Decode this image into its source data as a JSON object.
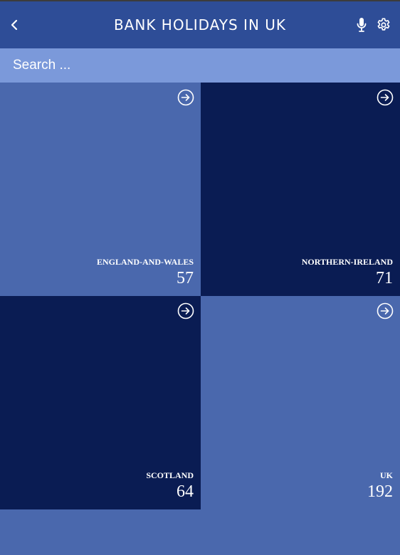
{
  "header": {
    "title": "BANK HOLIDAYS IN UK",
    "back_icon": "chevron-left-icon",
    "mic_icon": "microphone-icon",
    "settings_icon": "gear-icon"
  },
  "search": {
    "placeholder": "Search ...",
    "value": ""
  },
  "colors": {
    "header_bg": "#2e4d97",
    "search_bg": "#7b99da",
    "tile_light": "#4a68ad",
    "tile_dark": "#0a1c53",
    "text": "#ffffff"
  },
  "tiles": [
    {
      "name": "ENGLAND-AND-WALES",
      "count": "57",
      "icon": "arrow-circle-right-icon",
      "style": "light"
    },
    {
      "name": "NORTHERN-IRELAND",
      "count": "71",
      "icon": "arrow-circle-right-icon",
      "style": "dark"
    },
    {
      "name": "SCOTLAND",
      "count": "64",
      "icon": "arrow-circle-right-icon",
      "style": "dark"
    },
    {
      "name": "UK",
      "count": "192",
      "icon": "arrow-circle-right-icon",
      "style": "light"
    }
  ]
}
